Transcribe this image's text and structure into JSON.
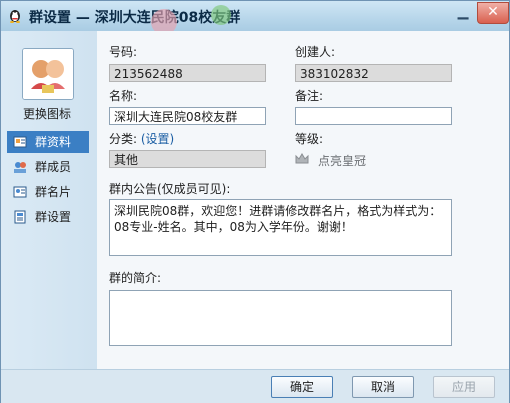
{
  "window": {
    "title": "群设置 — 深圳大连民院08校友群"
  },
  "sidebar": {
    "change_avatar_label": "更换图标",
    "items": [
      {
        "label": "群资料",
        "active": true,
        "icon": "group-info-icon"
      },
      {
        "label": "群成员",
        "active": false,
        "icon": "group-members-icon"
      },
      {
        "label": "群名片",
        "active": false,
        "icon": "group-card-icon"
      },
      {
        "label": "群设置",
        "active": false,
        "icon": "group-settings-icon"
      }
    ]
  },
  "form": {
    "group_number_label": "号码:",
    "group_number_value": "213562488",
    "creator_label": "创建人:",
    "creator_value": "383102832",
    "name_label": "名称:",
    "name_value": "深圳大连民院08校友群",
    "remark_label": "备注:",
    "remark_value": "",
    "category_label": "分类:",
    "category_link": "(设置)",
    "category_value": "其他",
    "level_label": "等级:",
    "level_link": "点亮皇冠",
    "announcement_label": "群内公告(仅成员可见):",
    "announcement_value": "深圳民院08群，欢迎您！进群请修改群名片，格式为样式为：08专业-姓名。其中，08为入学年份。谢谢！",
    "intro_label": "群的简介:",
    "intro_value": ""
  },
  "buttons": {
    "ok": "确定",
    "cancel": "取消",
    "apply": "应用"
  },
  "colors": {
    "accent": "#3b7fc4",
    "title_bar": "#b7d6ea",
    "close": "#d9604f"
  }
}
